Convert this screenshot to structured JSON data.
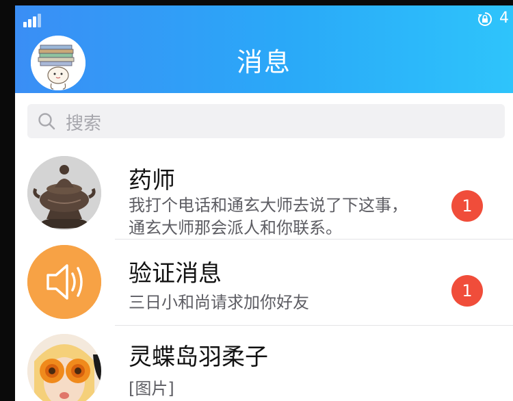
{
  "status_bar": {
    "signal_icon": "signal-bars-icon",
    "rotation_icon": "rotation-lock-icon",
    "indicator": "4"
  },
  "header": {
    "title": "消息",
    "avatar_icon": "avatar-books-icon"
  },
  "search": {
    "placeholder": "搜索",
    "icon": "search-icon"
  },
  "conversations": [
    {
      "name": "药师",
      "message_line1": "我打个电话和通玄大师去说了下这事，",
      "message_line2": "通玄大师那会派人和你联系。",
      "unread": "1",
      "avatar_icon": "bronze-censer-avatar"
    },
    {
      "name": "验证消息",
      "message_line1": "三日小和尚请求加你好友",
      "unread": "1",
      "avatar_icon": "speaker-icon"
    },
    {
      "name": "灵蝶岛羽柔子",
      "message_line1": "[图片]",
      "avatar_icon": "sunflower-girl-avatar"
    }
  ],
  "colors": {
    "header_start": "#3a8ef5",
    "header_end": "#2ec4fb",
    "badge": "#f04d3a",
    "verify_avatar": "#f7a245"
  }
}
